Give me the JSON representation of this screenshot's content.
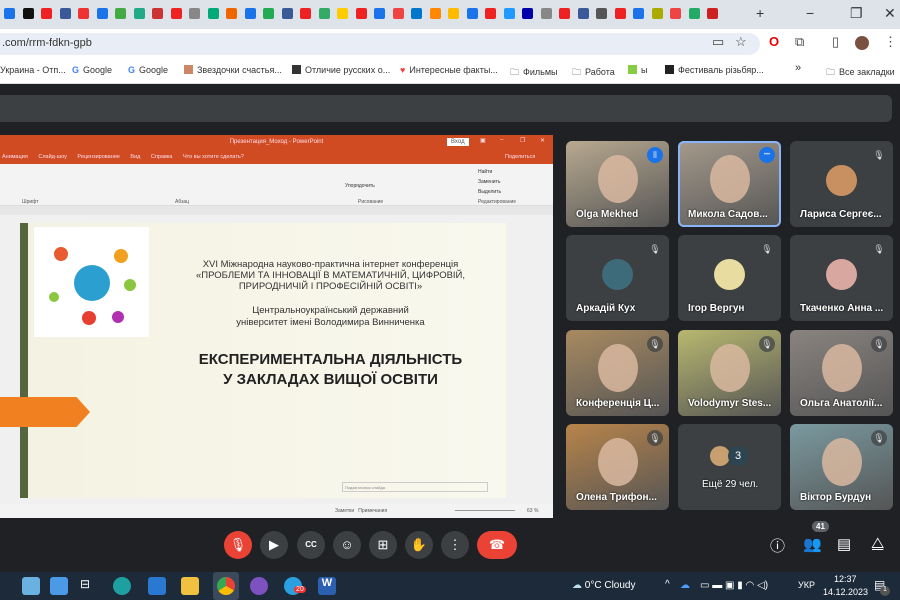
{
  "browser": {
    "url": ".com/rrm-fdkn-gpb",
    "new_tab": "+",
    "minimize": "−",
    "maximize": "❐",
    "close": "✕",
    "bookmarks": [
      {
        "label": "Украина - Отп..."
      },
      {
        "label": "Google"
      },
      {
        "label": "Google"
      },
      {
        "label": "Звездочки счастья..."
      },
      {
        "label": "Отличие русских о..."
      },
      {
        "label": "Интересные факты..."
      },
      {
        "label": "Фильмы"
      },
      {
        "label": "Работа"
      },
      {
        "label": "ы"
      },
      {
        "label": "Фестиваль різьбяр..."
      }
    ],
    "more_bookmarks": "»",
    "all_bookmarks": "Все закладки"
  },
  "powerpoint": {
    "title": "Презентация_Моход - PowerPoint",
    "signin": "Вход",
    "menu": [
      "Анимация",
      "Слайд-шоу",
      "Рецензирование",
      "Вид",
      "Справка",
      "Что вы хотите сделать?"
    ],
    "share": "Поделиться",
    "ribbon": {
      "font_group": "Шрифт",
      "paragraph_group": "Абзац",
      "drawing_group": "Рисование",
      "editing_group": "Редактирование",
      "arrange": "Упорядочить",
      "find": "Найти",
      "replace": "Заменить",
      "select": "Выделить"
    },
    "slide": {
      "line1": "XVI Міжнародна науково-практична інтернет конференція",
      "line2": "«ПРОБЛЕМИ ТА ІННОВАЦІЇ В МАТЕМАТИЧНІЙ, ЦИФРОВІЙ,",
      "line3": "ПРИРОДНИЧІЙ І ПРОФЕСІЙНІЙ ОСВІТІ»",
      "line4": "Центральноукраїнський державний",
      "line5": "університет імені Володимира Винниченка",
      "title1": "ЕКСПЕРИМЕНТАЛЬНА ДІЯЛЬНІСТЬ",
      "title2": "У ЗАКЛАДАХ ВИЩОЇ ОСВІТИ",
      "subtitle_placeholder": "Подзаголовок слайда"
    },
    "status": {
      "notes": "Заметки",
      "comments": "Примечания",
      "zoom": "63 %"
    }
  },
  "participants": [
    {
      "name": "Olga Mekhed",
      "state": "speaking",
      "bg": "#b8a990"
    },
    {
      "name": "Микола Садов...",
      "state": "more",
      "bg": "#a59a8c"
    },
    {
      "name": "Лариса Сергеє...",
      "state": "muted",
      "avatar": "#c89060"
    },
    {
      "name": "Аркадій Кух",
      "state": "muted",
      "avatar": "#3d6b7a"
    },
    {
      "name": "Ігор Вергун",
      "state": "muted",
      "avatar": "#e8dca0"
    },
    {
      "name": "Ткаченко Анна ...",
      "state": "muted",
      "avatar": "#d8a8a0"
    },
    {
      "name": "Конференція Ц...",
      "state": "muted",
      "bg": "#a88a60"
    },
    {
      "name": "Volodymyr Stes...",
      "state": "muted",
      "bg": "#b8b870"
    },
    {
      "name": "Ольга Анатолії...",
      "state": "muted",
      "bg": "#8a8480"
    },
    {
      "name": "Олена Трифон...",
      "state": "muted",
      "bg": "#b8844a"
    },
    {
      "name": "Ещё 29 чел.",
      "state": "others",
      "count": "3"
    },
    {
      "name": "Віктор Бурдун",
      "state": "muted",
      "bg": "#7a9aa0"
    }
  ],
  "controls": {
    "participants_count": "41",
    "end_call_color": "#ea4335",
    "mic_off_color": "#ea4335"
  },
  "taskbar": {
    "weather": "0°C  Cloudy",
    "lang": "УКР",
    "time": "12:37",
    "date": "14.12.2023",
    "notifications": "1",
    "telegram_badge": "20"
  }
}
